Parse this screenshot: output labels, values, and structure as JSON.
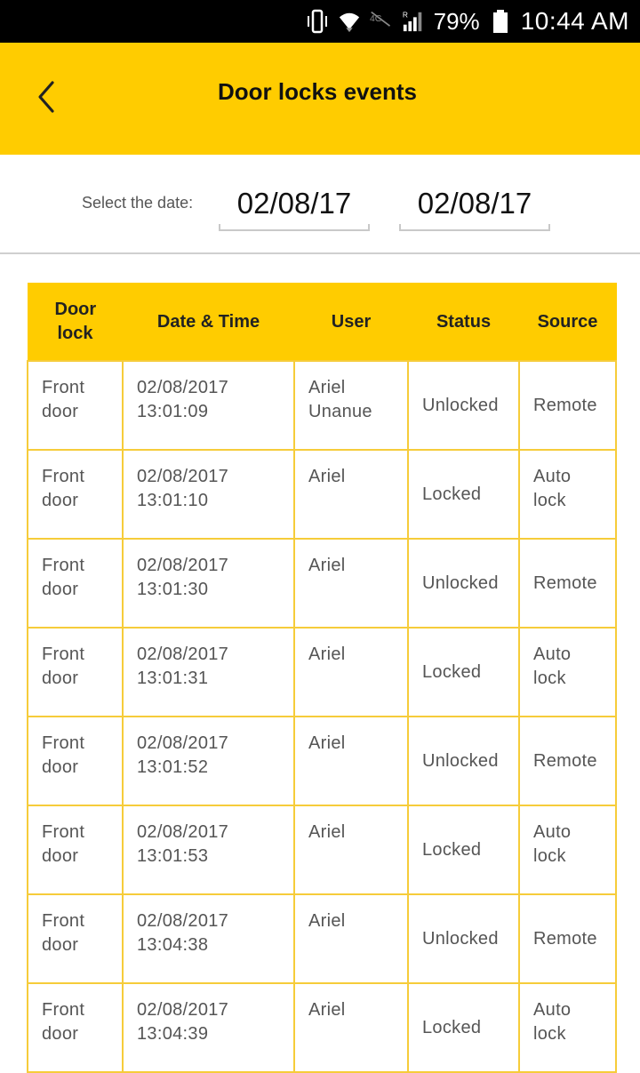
{
  "status_bar": {
    "battery_percent": "79%",
    "time": "10:44 AM",
    "icons": [
      "vibrate-icon",
      "wifi-icon",
      "roaming-icon",
      "signal-icon",
      "battery-icon"
    ]
  },
  "header": {
    "title": "Door locks events",
    "back_icon": "chevron-left-icon"
  },
  "date_filter": {
    "label": "Select the date:",
    "from": "02/08/17",
    "to": "02/08/17"
  },
  "table": {
    "columns": [
      "Door lock",
      "Date & Time",
      "User",
      "Status",
      "Source"
    ],
    "rows": [
      {
        "door": "Front door",
        "date": "02/08/2017",
        "time": "13:01:09",
        "user": "Ariel Unanue",
        "status": "Unlocked",
        "source": "Remote"
      },
      {
        "door": "Front door",
        "date": "02/08/2017",
        "time": "13:01:10",
        "user": "Ariel",
        "status": "Locked",
        "source": "Auto lock"
      },
      {
        "door": "Front door",
        "date": "02/08/2017",
        "time": "13:01:30",
        "user": "Ariel",
        "status": "Unlocked",
        "source": "Remote"
      },
      {
        "door": "Front door",
        "date": "02/08/2017",
        "time": "13:01:31",
        "user": "Ariel",
        "status": "Locked",
        "source": "Auto lock"
      },
      {
        "door": "Front door",
        "date": "02/08/2017",
        "time": "13:01:52",
        "user": "Ariel",
        "status": "Unlocked",
        "source": "Remote"
      },
      {
        "door": "Front door",
        "date": "02/08/2017",
        "time": "13:01:53",
        "user": "Ariel",
        "status": "Locked",
        "source": "Auto lock"
      },
      {
        "door": "Front door",
        "date": "02/08/2017",
        "time": "13:04:38",
        "user": "Ariel",
        "status": "Unlocked",
        "source": "Remote"
      },
      {
        "door": "Front door",
        "date": "02/08/2017",
        "time": "13:04:39",
        "user": "Ariel",
        "status": "Locked",
        "source": "Auto lock"
      }
    ]
  },
  "colors": {
    "accent": "#FFCC00",
    "cell_border": "#F6CC3A"
  }
}
